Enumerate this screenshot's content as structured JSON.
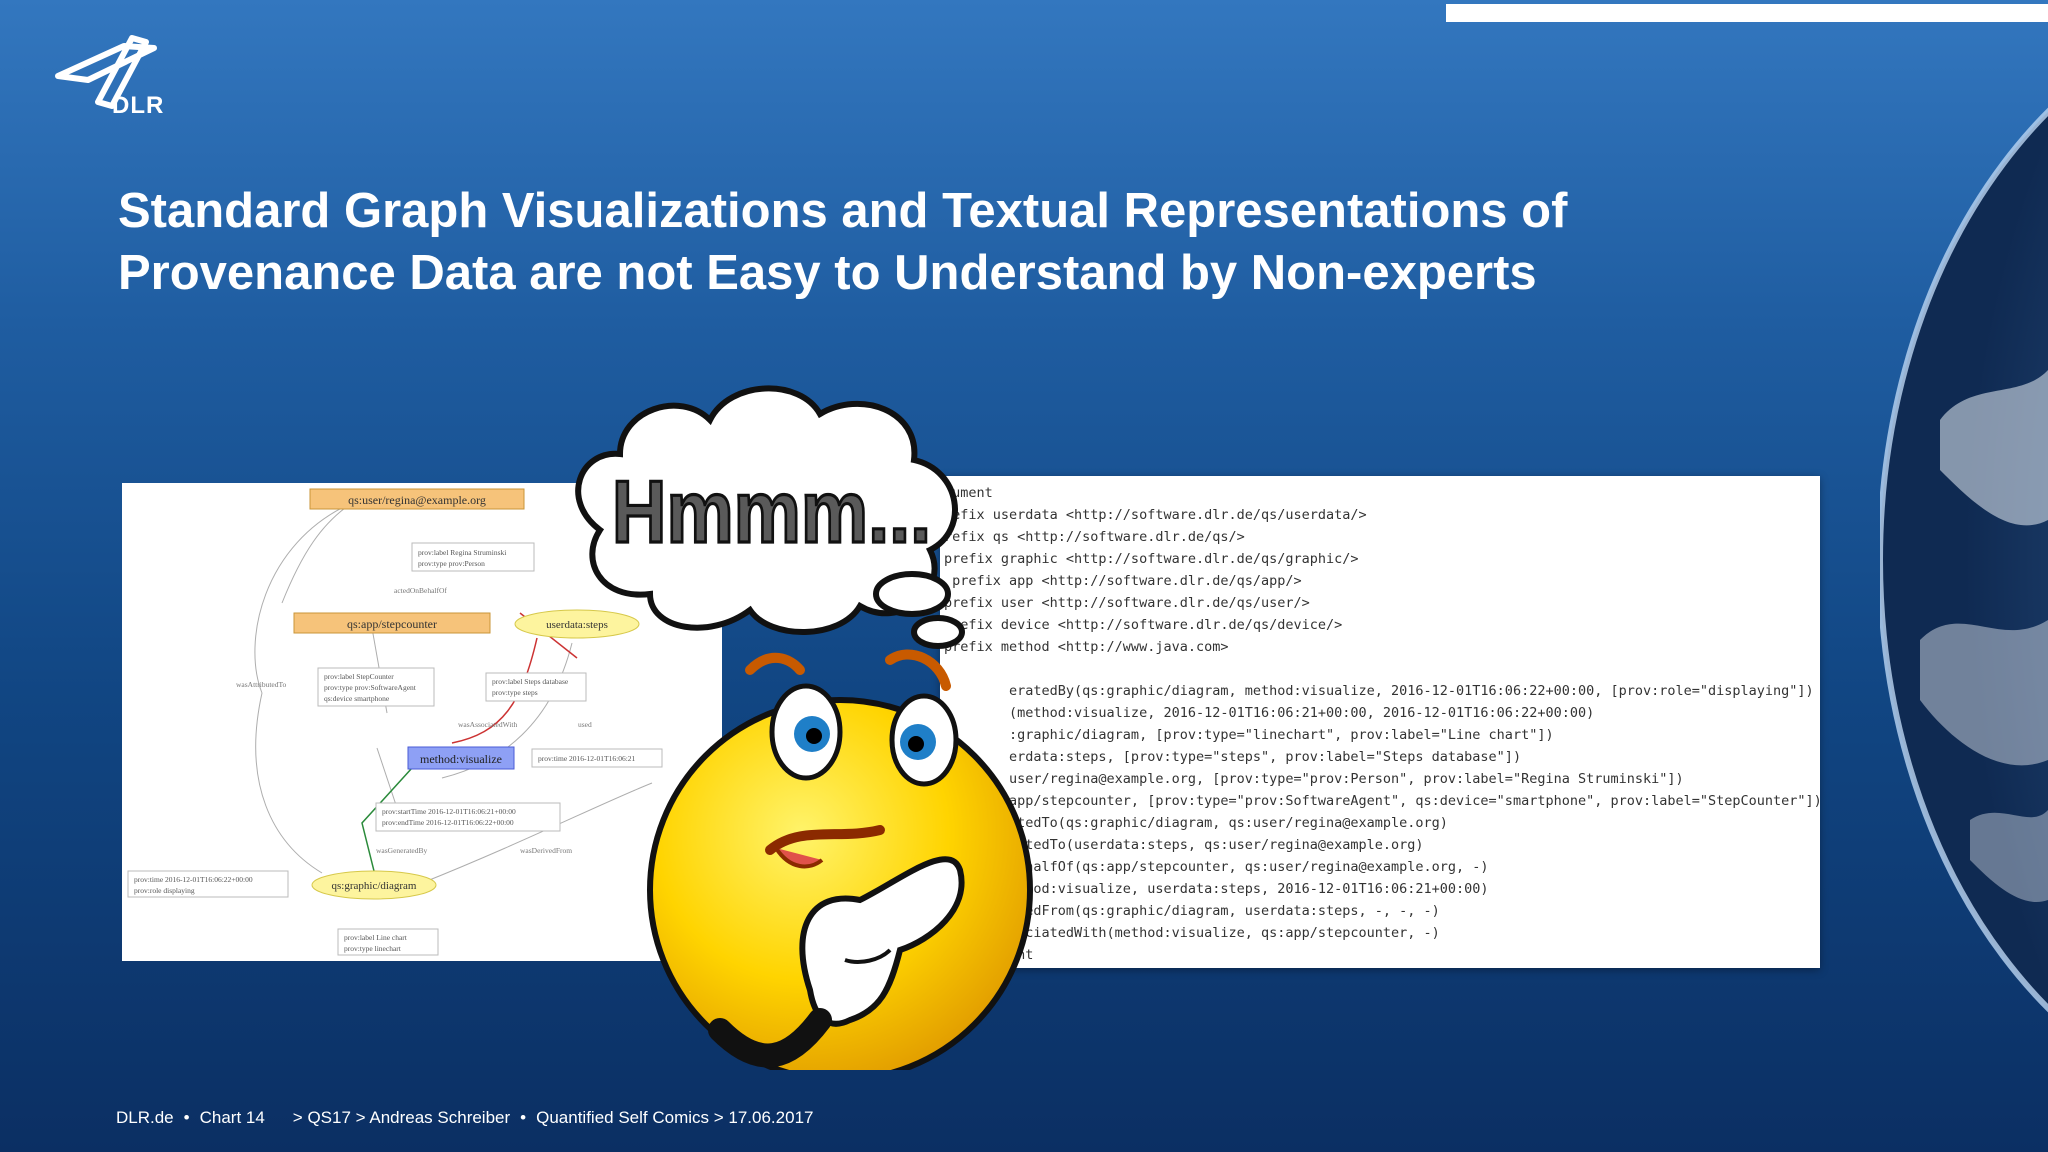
{
  "slide": {
    "title_line1": "Standard Graph Visualizations and Textual Representations of",
    "title_line2": "Provenance Data are not Easy to Understand by Non-experts",
    "logo_text": "DLR"
  },
  "graph": {
    "nodes": {
      "user": "qs:user/regina@example.org",
      "app": "qs:app/stepcounter",
      "steps": "userdata:steps",
      "method": "method:visualize",
      "diagram": "qs:graphic/diagram"
    },
    "notes": {
      "user_1": "prov:label Regina Struminski",
      "user_2": "prov:type prov:Person",
      "app_1": "prov:label StepCounter",
      "app_2": "prov:type prov:SoftwareAgent",
      "app_3": "qs:device smartphone",
      "steps_1": "prov:label Steps database",
      "steps_2": "prov:type steps",
      "method_1": "prov:startTime 2016-12-01T16:06:21+00:00",
      "method_2": "prov:endTime 2016-12-01T16:06:22+00:00",
      "method_right": "prov:time 2016-12-01T16:06:21",
      "diag_left_1": "prov:time 2016-12-01T16:06:22+00:00",
      "diag_left_2": "prov:role displaying",
      "diag_below_1": "prov:label Line chart",
      "diag_below_2": "prov:type linechart"
    },
    "edges": {
      "acted": "actedOnBehalfOf",
      "attributed": "wasAttributedTo",
      "associated": "wasAssociatedWith",
      "generated": "wasGeneratedBy",
      "derived": "wasDerivedFrom",
      "used": "used"
    }
  },
  "code": {
    "lines": [
      "cument",
      "refix userdata <http://software.dlr.de/qs/userdata/>",
      "refix qs <http://software.dlr.de/qs/>",
      "prefix graphic <http://software.dlr.de/qs/graphic/>",
      " prefix app <http://software.dlr.de/qs/app/>",
      "prefix user <http://software.dlr.de/qs/user/>",
      "prefix device <http://software.dlr.de/qs/device/>",
      "prefix method <http://www.java.com>",
      "",
      "        eratedBy(qs:graphic/diagram, method:visualize, 2016-12-01T16:06:22+00:00, [prov:role=\"displaying\"])",
      "        (method:visualize, 2016-12-01T16:06:21+00:00, 2016-12-01T16:06:22+00:00)",
      "        :graphic/diagram, [prov:type=\"linechart\", prov:label=\"Line chart\"])",
      "        erdata:steps, [prov:type=\"steps\", prov:label=\"Steps database\"])",
      "        user/regina@example.org, [prov:type=\"prov:Person\", prov:label=\"Regina Struminski\"])",
      "        app/stepcounter, [prov:type=\"prov:SoftwareAgent\", qs:device=\"smartphone\", prov:label=\"StepCounter\"])",
      "        utedTo(qs:graphic/diagram, qs:user/regina@example.org)",
      "        butedTo(userdata:steps, qs:user/regina@example.org)",
      "        BehalfOf(qs:app/stepcounter, qs:user/regina@example.org, -)",
      "       method:visualize, userdata:steps, 2016-12-01T16:06:21+00:00)",
      "      erivedFrom(qs:graphic/diagram, userdata:steps, -, -, -)",
      "   wasAssociatedWith(method:visualize, qs:app/stepcounter, -)",
      "endDocument"
    ]
  },
  "mascot": {
    "bubble_text": "Hmmm..."
  },
  "footer": {
    "site": "DLR.de",
    "chart": "Chart 14",
    "path": "> QS17 > Andreas Schreiber",
    "event": "Quantified Self Comics > 17.06.2017"
  }
}
